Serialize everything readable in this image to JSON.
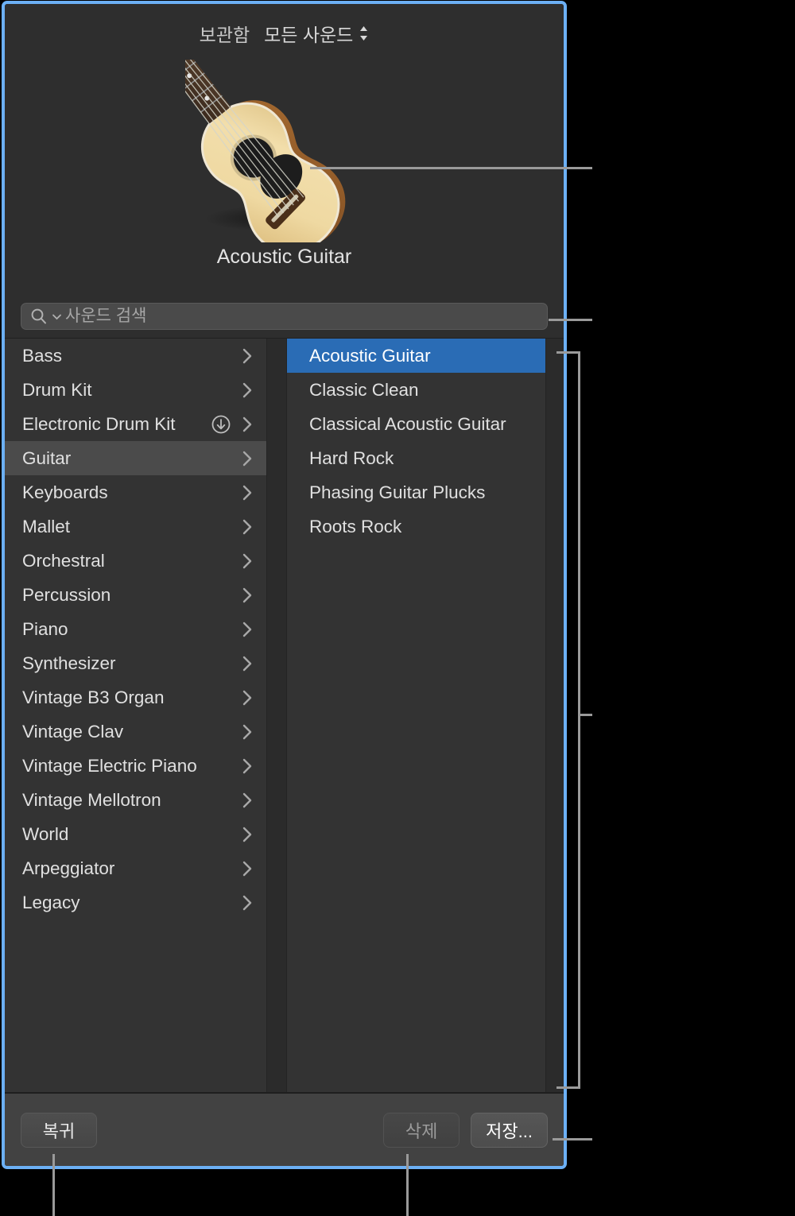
{
  "window": {
    "accent_border_color": "#6cb0f5",
    "background_color": "#2e2e2e"
  },
  "header": {
    "library_label": "보관함",
    "popup_label": "모든 사운드",
    "popup_icon": "up-down-chevron-icon"
  },
  "hero": {
    "artwork_icon": "acoustic-guitar-image",
    "title": "Acoustic Guitar"
  },
  "search": {
    "icon": "search-icon",
    "dropdown_icon": "chevron-down-icon",
    "placeholder": "사운드 검색",
    "value": ""
  },
  "browser": {
    "categories": [
      {
        "label": "Bass",
        "selected": false,
        "download": false
      },
      {
        "label": "Drum Kit",
        "selected": false,
        "download": false
      },
      {
        "label": "Electronic Drum Kit",
        "selected": false,
        "download": true
      },
      {
        "label": "Guitar",
        "selected": true,
        "download": false
      },
      {
        "label": "Keyboards",
        "selected": false,
        "download": false
      },
      {
        "label": "Mallet",
        "selected": false,
        "download": false
      },
      {
        "label": "Orchestral",
        "selected": false,
        "download": false
      },
      {
        "label": "Percussion",
        "selected": false,
        "download": false
      },
      {
        "label": "Piano",
        "selected": false,
        "download": false
      },
      {
        "label": "Synthesizer",
        "selected": false,
        "download": false
      },
      {
        "label": "Vintage B3 Organ",
        "selected": false,
        "download": false
      },
      {
        "label": "Vintage Clav",
        "selected": false,
        "download": false
      },
      {
        "label": "Vintage Electric Piano",
        "selected": false,
        "download": false
      },
      {
        "label": "Vintage Mellotron",
        "selected": false,
        "download": false
      },
      {
        "label": "World",
        "selected": false,
        "download": false
      },
      {
        "label": "Arpeggiator",
        "selected": false,
        "download": false
      },
      {
        "label": "Legacy",
        "selected": false,
        "download": false
      }
    ],
    "presets": [
      {
        "label": "Acoustic Guitar",
        "selected": true
      },
      {
        "label": "Classic Clean",
        "selected": false
      },
      {
        "label": "Classical Acoustic Guitar",
        "selected": false
      },
      {
        "label": "Hard Rock",
        "selected": false
      },
      {
        "label": "Phasing Guitar Plucks",
        "selected": false
      },
      {
        "label": "Roots Rock",
        "selected": false
      }
    ],
    "selection_color": "#2a6cb5",
    "category_highlight_color": "#4b4b4b"
  },
  "footer": {
    "revert_label": "복귀",
    "delete_label": "삭제",
    "save_label": "저장...",
    "delete_enabled": false
  },
  "callouts": {
    "line_color": "#9a9a9a",
    "items": [
      "artwork-callout",
      "search-field-callout",
      "browser-bracket-callout",
      "revert-button-callout",
      "delete-button-callout",
      "save-button-callout"
    ]
  }
}
